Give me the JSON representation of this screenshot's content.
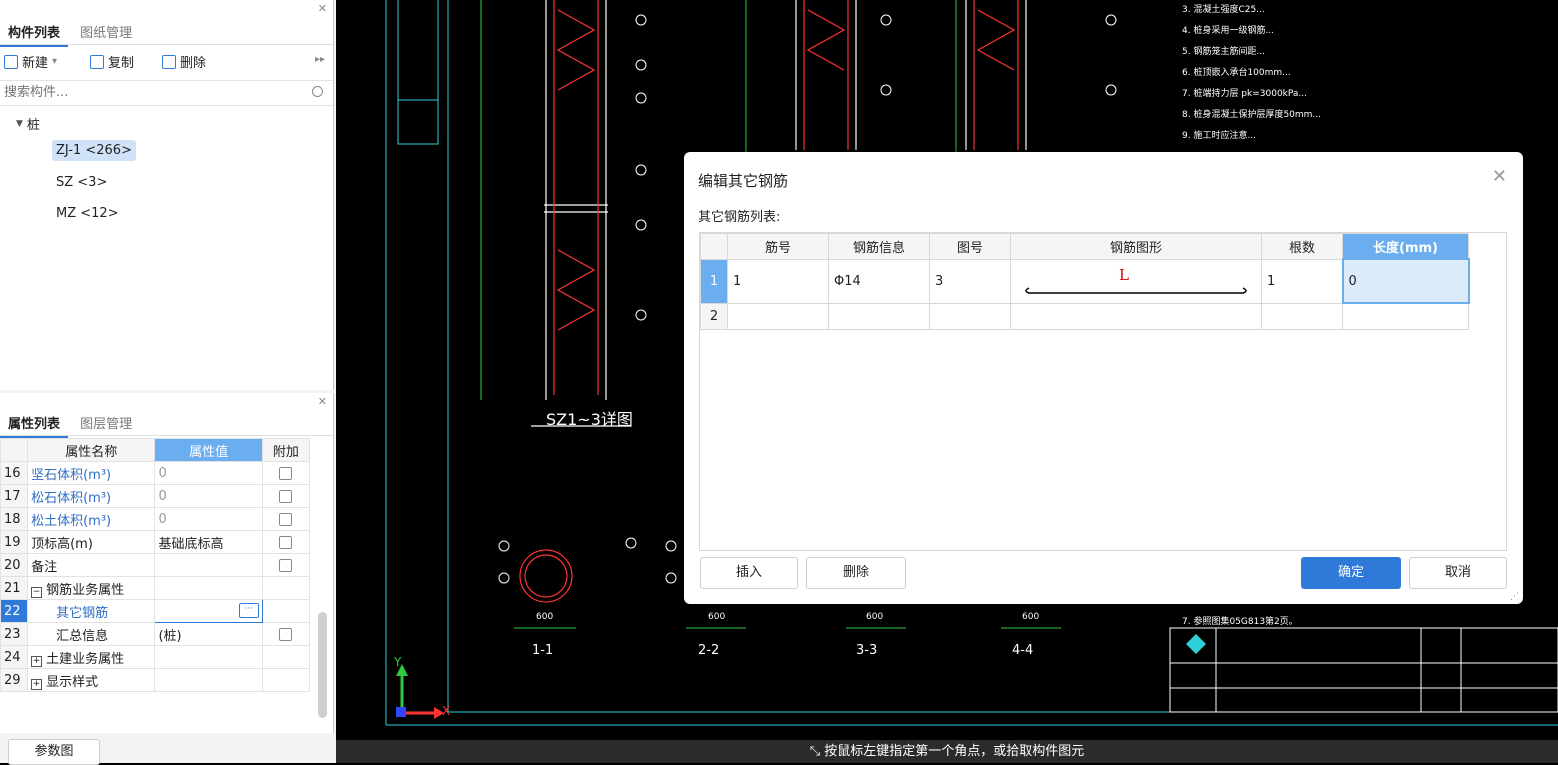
{
  "component_panel": {
    "tabs": [
      "构件列表",
      "图纸管理"
    ],
    "toolbar": {
      "new_label": "新建",
      "copy_label": "复制",
      "delete_label": "删除"
    },
    "search_placeholder": "搜索构件...",
    "tree": {
      "root": "桩",
      "items": [
        "ZJ-1 <266>",
        "SZ <3>",
        "MZ <12>"
      ]
    }
  },
  "property_panel": {
    "tabs": [
      "属性列表",
      "图层管理"
    ],
    "headers": [
      "属性名称",
      "属性值",
      "附加"
    ],
    "rows": [
      {
        "num": "16",
        "name": "坚石体积(m³)",
        "value": "0"
      },
      {
        "num": "17",
        "name": "松石体积(m³)",
        "value": "0"
      },
      {
        "num": "18",
        "name": "松土体积(m³)",
        "value": "0"
      },
      {
        "num": "19",
        "name": "顶标高(m)",
        "value": "基础底标高"
      },
      {
        "num": "20",
        "name": "备注",
        "value": ""
      },
      {
        "num": "21",
        "name": "钢筋业务属性",
        "value": ""
      },
      {
        "num": "22",
        "name": "其它钢筋",
        "value": ""
      },
      {
        "num": "23",
        "name": "汇总信息",
        "value": "(桩)"
      },
      {
        "num": "24",
        "name": "土建业务属性",
        "value": ""
      },
      {
        "num": "29",
        "name": "显示样式",
        "value": ""
      }
    ],
    "param_button": "参数图"
  },
  "cad": {
    "detail_title": "SZ1~3详图",
    "sections": [
      "1-1",
      "2-2",
      "3-3",
      "4-4"
    ],
    "dim_600": "600",
    "notes": [
      "3. 混凝土强度C25...",
      "4. 桩身采用一级钢筋...",
      "5. 钢筋笼主筋间距...",
      "6. 桩顶嵌入承台100mm...",
      "7. 桩端持力层 pk=3000kPa...",
      "8. 桩身混凝土保护层厚度50mm...",
      "9. 施工时应注意..."
    ],
    "ref_note": "7. 参照图集05G813第2页。",
    "axis_y": "Y",
    "axis_x": "X"
  },
  "dialog": {
    "title": "编辑其它钢筋",
    "subtitle": "其它钢筋列表:",
    "columns": [
      "筋号",
      "钢筋信息",
      "图号",
      "钢筋图形",
      "根数",
      "长度(mm)"
    ],
    "rows": [
      {
        "rn": "1",
        "no": "1",
        "info": "Φ14",
        "fig": "3",
        "shape": "L",
        "count": "1",
        "length": "0"
      },
      {
        "rn": "2",
        "no": "",
        "info": "",
        "fig": "",
        "shape": "",
        "count": "",
        "length": ""
      }
    ],
    "insert_label": "插入",
    "delete_label": "删除",
    "ok_label": "确定",
    "cancel_label": "取消"
  },
  "status_bar": "按鼠标左键指定第一个角点，或拾取构件图元"
}
